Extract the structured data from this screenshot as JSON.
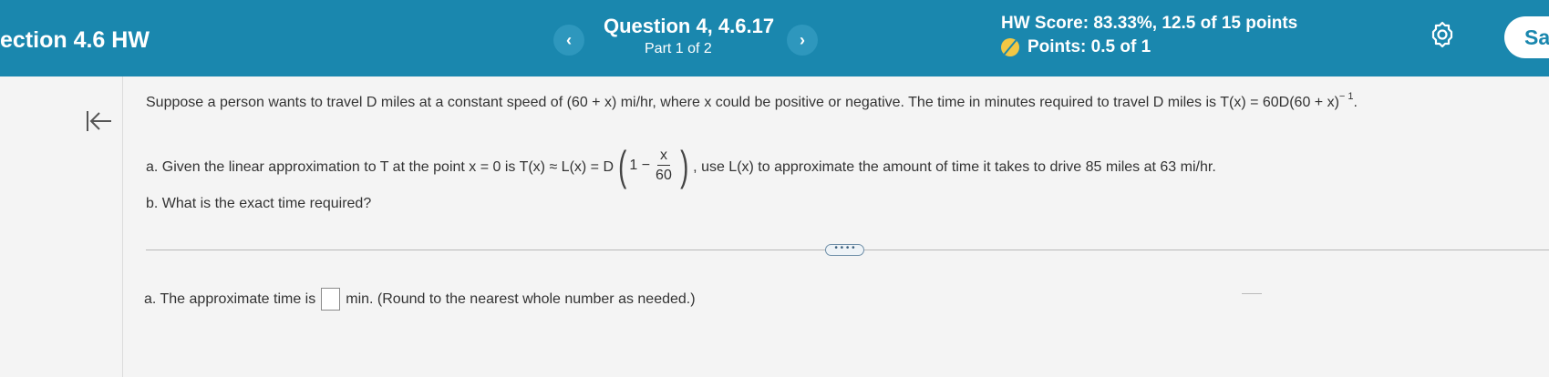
{
  "header": {
    "section_title": "ection 4.6 HW",
    "question_title": "Question 4, 4.6.17",
    "question_part": "Part 1 of 2",
    "prev_label": "‹",
    "next_label": "›",
    "hw_score": "HW Score: 83.33%, 12.5 of 15 points",
    "points": "Points: 0.5 of 1",
    "save_label": "Sa"
  },
  "question": {
    "intro": "Suppose a person wants to travel D miles at a constant speed of (60 + x) mi/hr, where x could be positive or negative. The time in minutes required to travel D miles is T(x) = 60D(60 + x)",
    "intro_exp": "− 1",
    "intro_end": ".",
    "part_a_before": "a. Given the linear approximation to T at the point x = 0 is T(x) ≈ L(x) = D",
    "part_a_one_minus": "1 −",
    "frac_num": "x",
    "frac_den": "60",
    "part_a_after": ", use L(x) to approximate the amount of time it takes to drive 85 miles at 63 mi/hr.",
    "part_b": "b. What is the exact time required?"
  },
  "expand_label": "• • • •",
  "answer": {
    "prefix": "a. The approximate time is",
    "suffix": "min. (Round to the nearest whole number as needed.)",
    "value": ""
  },
  "colors": {
    "header_bg": "#1a87ae",
    "points_icon": "#f2c744"
  }
}
